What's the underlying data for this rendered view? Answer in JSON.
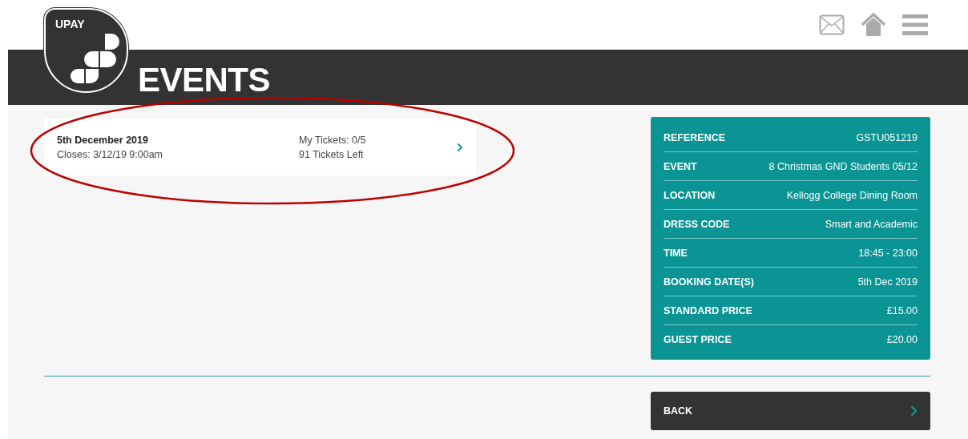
{
  "header": {
    "logo_text": "UPAY",
    "title": "EVENTS"
  },
  "events": [
    {
      "date": "5th December 2019",
      "closes": "Closes: 3/12/19 9:00am",
      "my_tickets": "My Tickets: 0/5",
      "tickets_left": "91 Tickets Left"
    }
  ],
  "details": [
    {
      "label": "REFERENCE",
      "value": "GSTU051219"
    },
    {
      "label": "EVENT",
      "value": "8 Christmas GND Students 05/12"
    },
    {
      "label": "LOCATION",
      "value": "Kellogg College Dining Room"
    },
    {
      "label": "DRESS CODE",
      "value": "Smart and Academic"
    },
    {
      "label": "TIME",
      "value": "18:45 - 23:00"
    },
    {
      "label": "BOOKING DATE(S)",
      "value": "5th Dec 2019"
    },
    {
      "label": "STANDARD PRICE",
      "value": "£15.00"
    },
    {
      "label": "GUEST PRICE",
      "value": "£20.00"
    }
  ],
  "back_button": {
    "label": "BACK"
  }
}
